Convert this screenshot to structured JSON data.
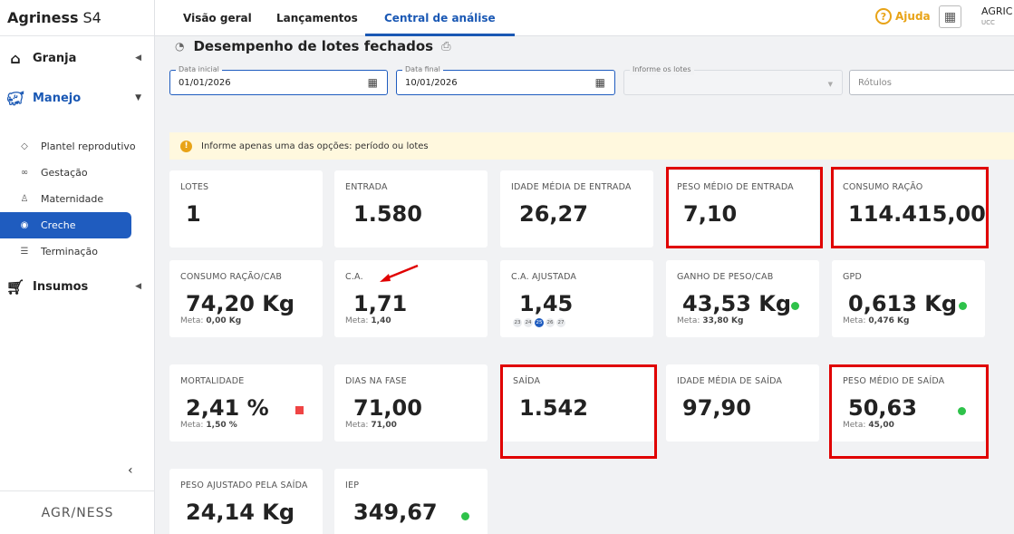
{
  "app": {
    "brand_bold": "Agriness",
    "brand_rest": "S4",
    "footer_logo": "AGR/NESS"
  },
  "sidebar": {
    "groups": [
      {
        "label": "Granja",
        "icon": "home-icon"
      },
      {
        "label": "Manejo",
        "icon": "pig-icon"
      },
      {
        "label": "Insumos",
        "icon": "cart-icon"
      }
    ],
    "items": [
      {
        "label": "Plantel reprodutivo"
      },
      {
        "label": "Gestação"
      },
      {
        "label": "Maternidade"
      },
      {
        "label": "Creche"
      },
      {
        "label": "Terminação"
      }
    ],
    "collapse_glyph": "‹"
  },
  "topbar": {
    "tabs": [
      "Visão geral",
      "Lançamentos",
      "Central de análise"
    ],
    "active_tab": "Central de análise",
    "help_label": "Ajuda",
    "user_name": "AGRIC",
    "user_sub": "UCC"
  },
  "page": {
    "title": "Desempenho de lotes fechados"
  },
  "filters": {
    "start_label": "Data inicial",
    "start_value": "01/01/2026",
    "end_label": "Data final",
    "end_value": "10/01/2026",
    "lots_label": "Informe os lotes",
    "tags_placeholder": "Rótulos"
  },
  "notice": "Informe apenas uma das opções: período ou lotes",
  "cards": [
    {
      "label": "LOTES",
      "value": "1"
    },
    {
      "label": "ENTRADA",
      "value": "1.580"
    },
    {
      "label": "IDADE MÉDIA DE ENTRADA",
      "value": "26,27"
    },
    {
      "label": "PESO MÉDIO DE ENTRADA",
      "value": "7,10"
    },
    {
      "label": "CONSUMO RAÇÃO",
      "value": "114.415,00"
    },
    {
      "label": "CONSUMO RAÇÃO/CAB",
      "value": "74,20 Kg",
      "meta_label": "Meta:",
      "meta_value": "0,00 Kg"
    },
    {
      "label": "C.A.",
      "value": "1,71",
      "meta_label": "Meta:",
      "meta_value": "1,40"
    },
    {
      "label": "C.A. AJUSTADA",
      "value": "1,45",
      "pages": [
        "23",
        "24",
        "25",
        "26",
        "27"
      ]
    },
    {
      "label": "GANHO DE PESO/CAB",
      "value": "43,53 Kg",
      "meta_label": "Meta:",
      "meta_value": "33,80 Kg"
    },
    {
      "label": "GPD",
      "value": "0,613 Kg",
      "meta_label": "Meta:",
      "meta_value": "0,476 Kg"
    },
    {
      "label": "MORTALIDADE",
      "value": "2,41 %",
      "meta_label": "Meta:",
      "meta_value": "1,50 %"
    },
    {
      "label": "DIAS NA FASE",
      "value": "71,00",
      "meta_label": "Meta:",
      "meta_value": "71,00"
    },
    {
      "label": "SAÍDA",
      "value": "1.542"
    },
    {
      "label": "IDADE MÉDIA DE SAÍDA",
      "value": "97,90"
    },
    {
      "label": "PESO MÉDIO DE SAÍDA",
      "value": "50,63",
      "meta_label": "Meta:",
      "meta_value": "45,00"
    },
    {
      "label": "PESO AJUSTADO PELA SAÍDA",
      "value": "24,14 Kg"
    },
    {
      "label": "IEP",
      "value": "349,67"
    }
  ],
  "colors": {
    "accent": "#1f5cbf",
    "ok": "#2ec24a",
    "alert": "#ef4444",
    "highlight": "#e00000",
    "help": "#e8a317"
  }
}
